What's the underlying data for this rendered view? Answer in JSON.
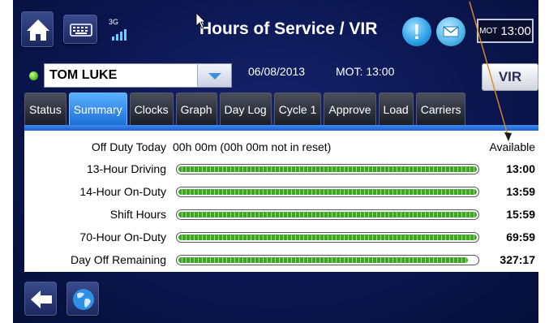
{
  "header": {
    "title": "Hours of Service / VIR",
    "network": "3G",
    "clock": {
      "tz": "MOT",
      "time": "13:00"
    }
  },
  "driver": {
    "name": "TOM LUKE",
    "date": "06/08/2013",
    "mot": "MOT: 13:00"
  },
  "vir_button": "VIR",
  "tabs": [
    "Status",
    "Summary",
    "Clocks",
    "Graph",
    "Day Log",
    "Cycle 1",
    "Approve",
    "Load",
    "Carriers"
  ],
  "active_tab": "Summary",
  "summary": {
    "off_duty_label": "Off Duty Today",
    "off_duty_value": "00h 00m (00h 00m not in reset)",
    "available_heading": "Available",
    "rows": [
      {
        "label": "13-Hour Driving",
        "available": "13:00",
        "fill": 1.0
      },
      {
        "label": "14-Hour On-Duty",
        "available": "13:59",
        "fill": 1.0
      },
      {
        "label": "Shift Hours",
        "available": "15:59",
        "fill": 1.0
      },
      {
        "label": "70-Hour On-Duty",
        "available": "69:59",
        "fill": 1.0
      },
      {
        "label": "Day Off Remaining",
        "available": "327:17",
        "fill": 0.97
      }
    ]
  },
  "icons": {
    "home": "home-icon",
    "keyboard": "keyboard-icon",
    "alert": "alert-icon",
    "mail": "mail-icon",
    "back": "back-arrow-icon",
    "globe": "globe-icon",
    "signal": "signal-bars-icon",
    "cursor": "mouse-cursor-icon"
  },
  "colors": {
    "background": "#0b1650",
    "active_tab": "#2a82ea",
    "progress_green": "#3fa52a",
    "annotation_arrow": "#e08a1e"
  }
}
